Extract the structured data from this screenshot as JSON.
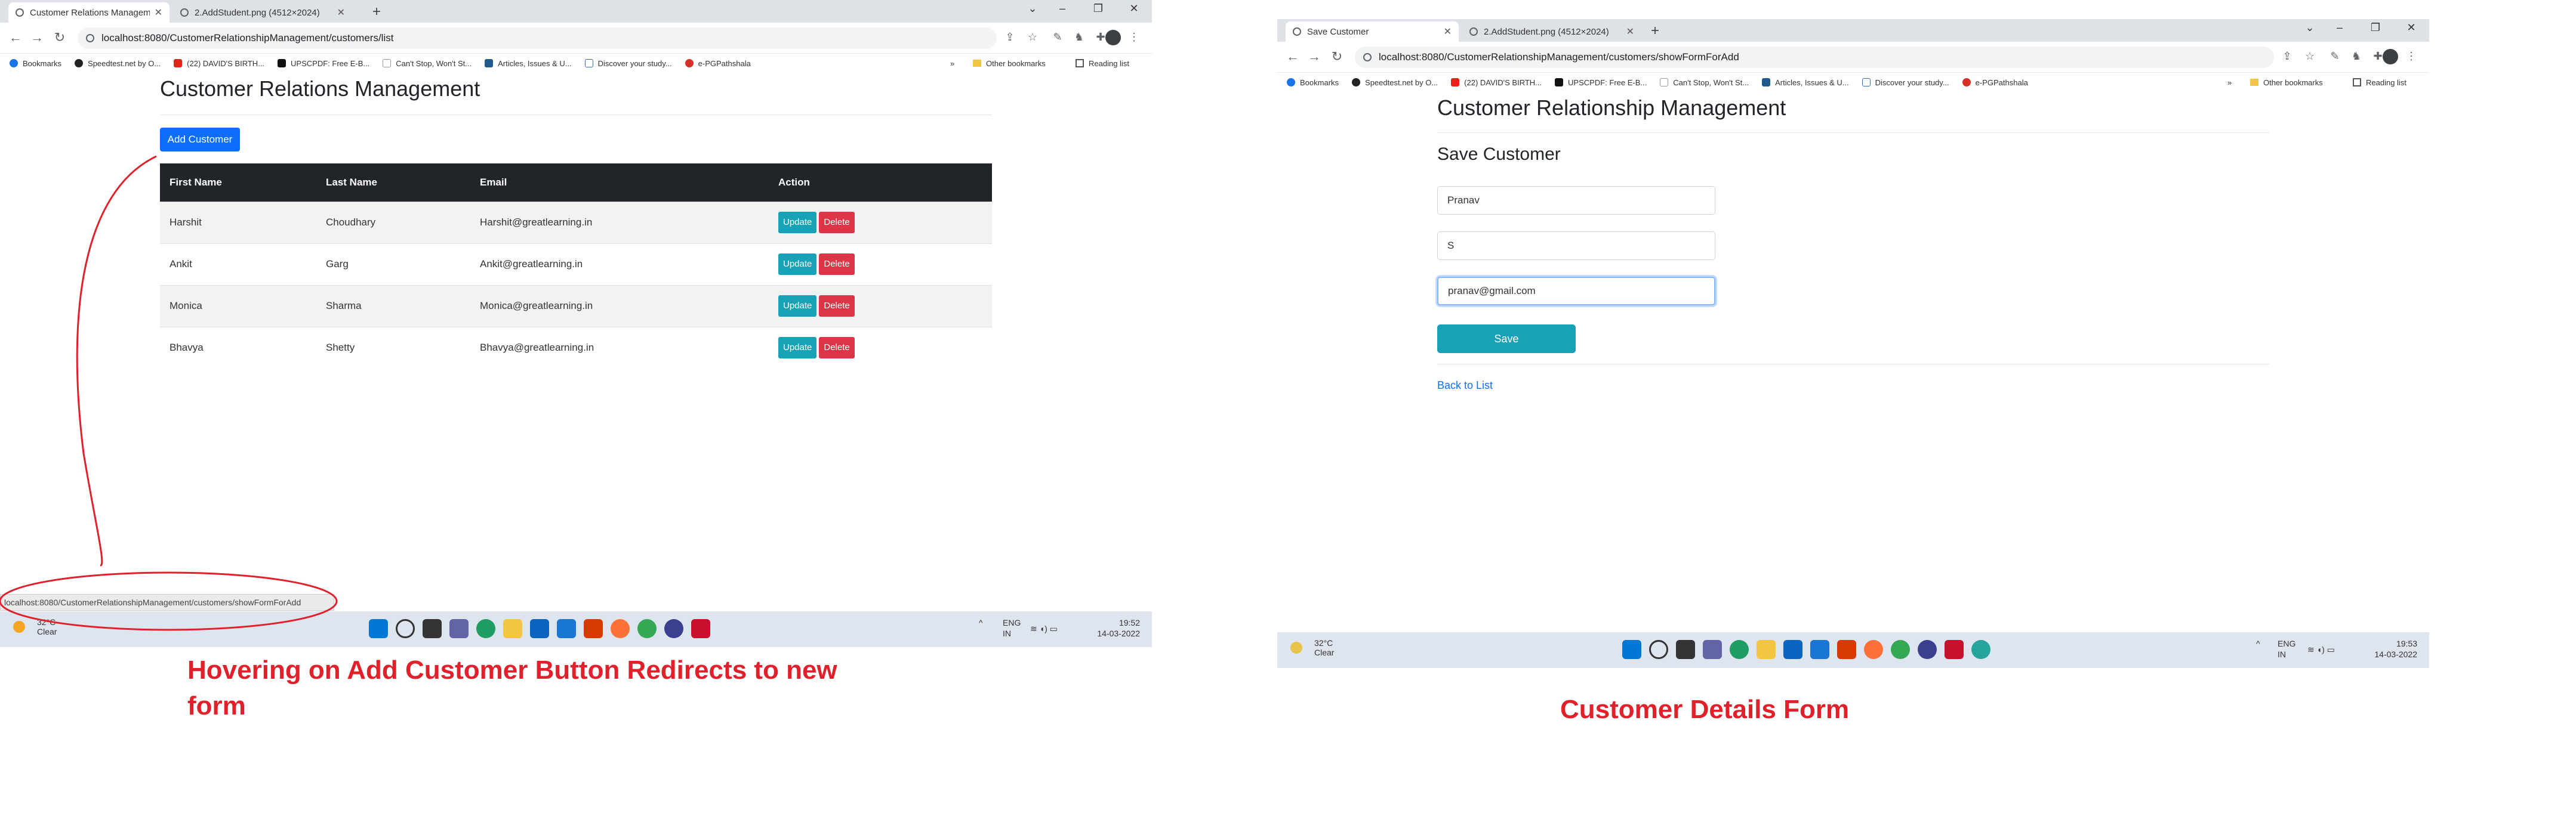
{
  "screen1": {
    "tabs": [
      {
        "label": "Customer Relations Managemen"
      },
      {
        "label": "2.AddStudent.png (4512×2024)"
      }
    ],
    "url": "localhost:8080/CustomerRelationshipManagement/customers/list",
    "bookmarks": [
      "Bookmarks",
      "Speedtest.net by O...",
      "(22) DAVID'S BIRTH...",
      "UPSCPDF: Free E-B...",
      "Can't Stop, Won't St...",
      "Articles, Issues & U...",
      "Discover your study...",
      "e-PGPathshala"
    ],
    "bookmarks_right": {
      "other": "Other bookmarks",
      "reading": "Reading list"
    },
    "page_title": "Customer Relations Management",
    "add_button": "Add Customer",
    "table": {
      "headers": [
        "First Name",
        "Last Name",
        "Email",
        "Action"
      ],
      "rows": [
        {
          "first": "Harshit",
          "last": "Choudhary",
          "email": "Harshit@greatlearning.in"
        },
        {
          "first": "Ankit",
          "last": "Garg",
          "email": "Ankit@greatlearning.in"
        },
        {
          "first": "Monica",
          "last": "Sharma",
          "email": "Monica@greatlearning.in"
        },
        {
          "first": "Bhavya",
          "last": "Shetty",
          "email": "Bhavya@greatlearning.in"
        }
      ],
      "update_label": "Update",
      "delete_label": "Delete"
    },
    "status_url": "localhost:8080/CustomerRelationshipManagement/customers/showFormForAdd",
    "taskbar": {
      "temp": "32°C",
      "cond": "Clear",
      "lang1": "ENG",
      "lang2": "IN",
      "time": "19:52",
      "date": "14-03-2022"
    }
  },
  "screen2": {
    "tabs": [
      {
        "label": "Save Customer"
      },
      {
        "label": "2.AddStudent.png (4512×2024)"
      }
    ],
    "url": "localhost:8080/CustomerRelationshipManagement/customers/showFormForAdd",
    "bookmarks": [
      "Bookmarks",
      "Speedtest.net by O...",
      "(22) DAVID'S BIRTH...",
      "UPSCPDF: Free E-B...",
      "Can't Stop, Won't St...",
      "Articles, Issues & U...",
      "Discover your study...",
      "e-PGPathshala"
    ],
    "bookmarks_right": {
      "other": "Other bookmarks",
      "reading": "Reading list"
    },
    "page_title": "Customer Relationship Management",
    "form_title": "Save Customer",
    "fields": {
      "first_name": "Pranav",
      "last_name": "S",
      "email": "pranav@gmail.com"
    },
    "save_button": "Save",
    "back_link": "Back to List",
    "taskbar": {
      "temp": "32°C",
      "cond": "Clear",
      "lang1": "ENG",
      "lang2": "IN",
      "time": "19:53",
      "date": "14-03-2022"
    }
  },
  "annotations": {
    "caption1": "Hovering on Add Customer Button Redirects to new form",
    "caption2": "Customer Details Form",
    "color": "#e0202a"
  },
  "icons": {
    "back": "back-arrow-icon",
    "forward": "forward-arrow-icon",
    "reload": "reload-icon",
    "star": "bookmark-star-icon",
    "extensions": "puzzle-icon",
    "sun": "sun-icon"
  }
}
